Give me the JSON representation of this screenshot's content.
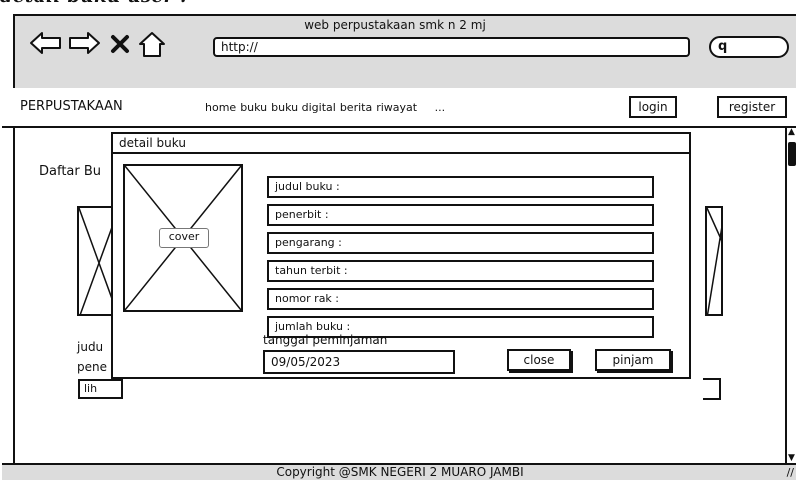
{
  "caption": "detail buku user :",
  "browser": {
    "title": "web perpustakaan smk n 2 mj",
    "url": "http://"
  },
  "icons": {
    "back": "arrow-left-icon",
    "forward": "arrow-right-icon",
    "stop": "close-icon",
    "home": "home-icon",
    "search": "search-icon"
  },
  "navbar": {
    "brand": "PERPUSTAKAAN",
    "menu": [
      "home",
      "buku",
      "buku digital",
      "berita",
      "riwayat"
    ],
    "more": "...",
    "login": "login",
    "register": "register"
  },
  "page": {
    "list_title": "Daftar Bu",
    "bg_texts": [
      "judu",
      "pene"
    ],
    "bg_button": "lih"
  },
  "modal": {
    "title": "detail buku",
    "cover_label": "cover",
    "fields": [
      "judul buku :",
      "penerbit :",
      "pengarang :",
      "tahun terbit :",
      "nomor rak :",
      "jumlah buku :"
    ],
    "date_label": "tanggal peminjaman",
    "date_value": "09/05/2023",
    "close": "close",
    "pinjam": "pinjam"
  },
  "footer": "Copyright @SMK NEGERI 2 MUARO JAMBI"
}
